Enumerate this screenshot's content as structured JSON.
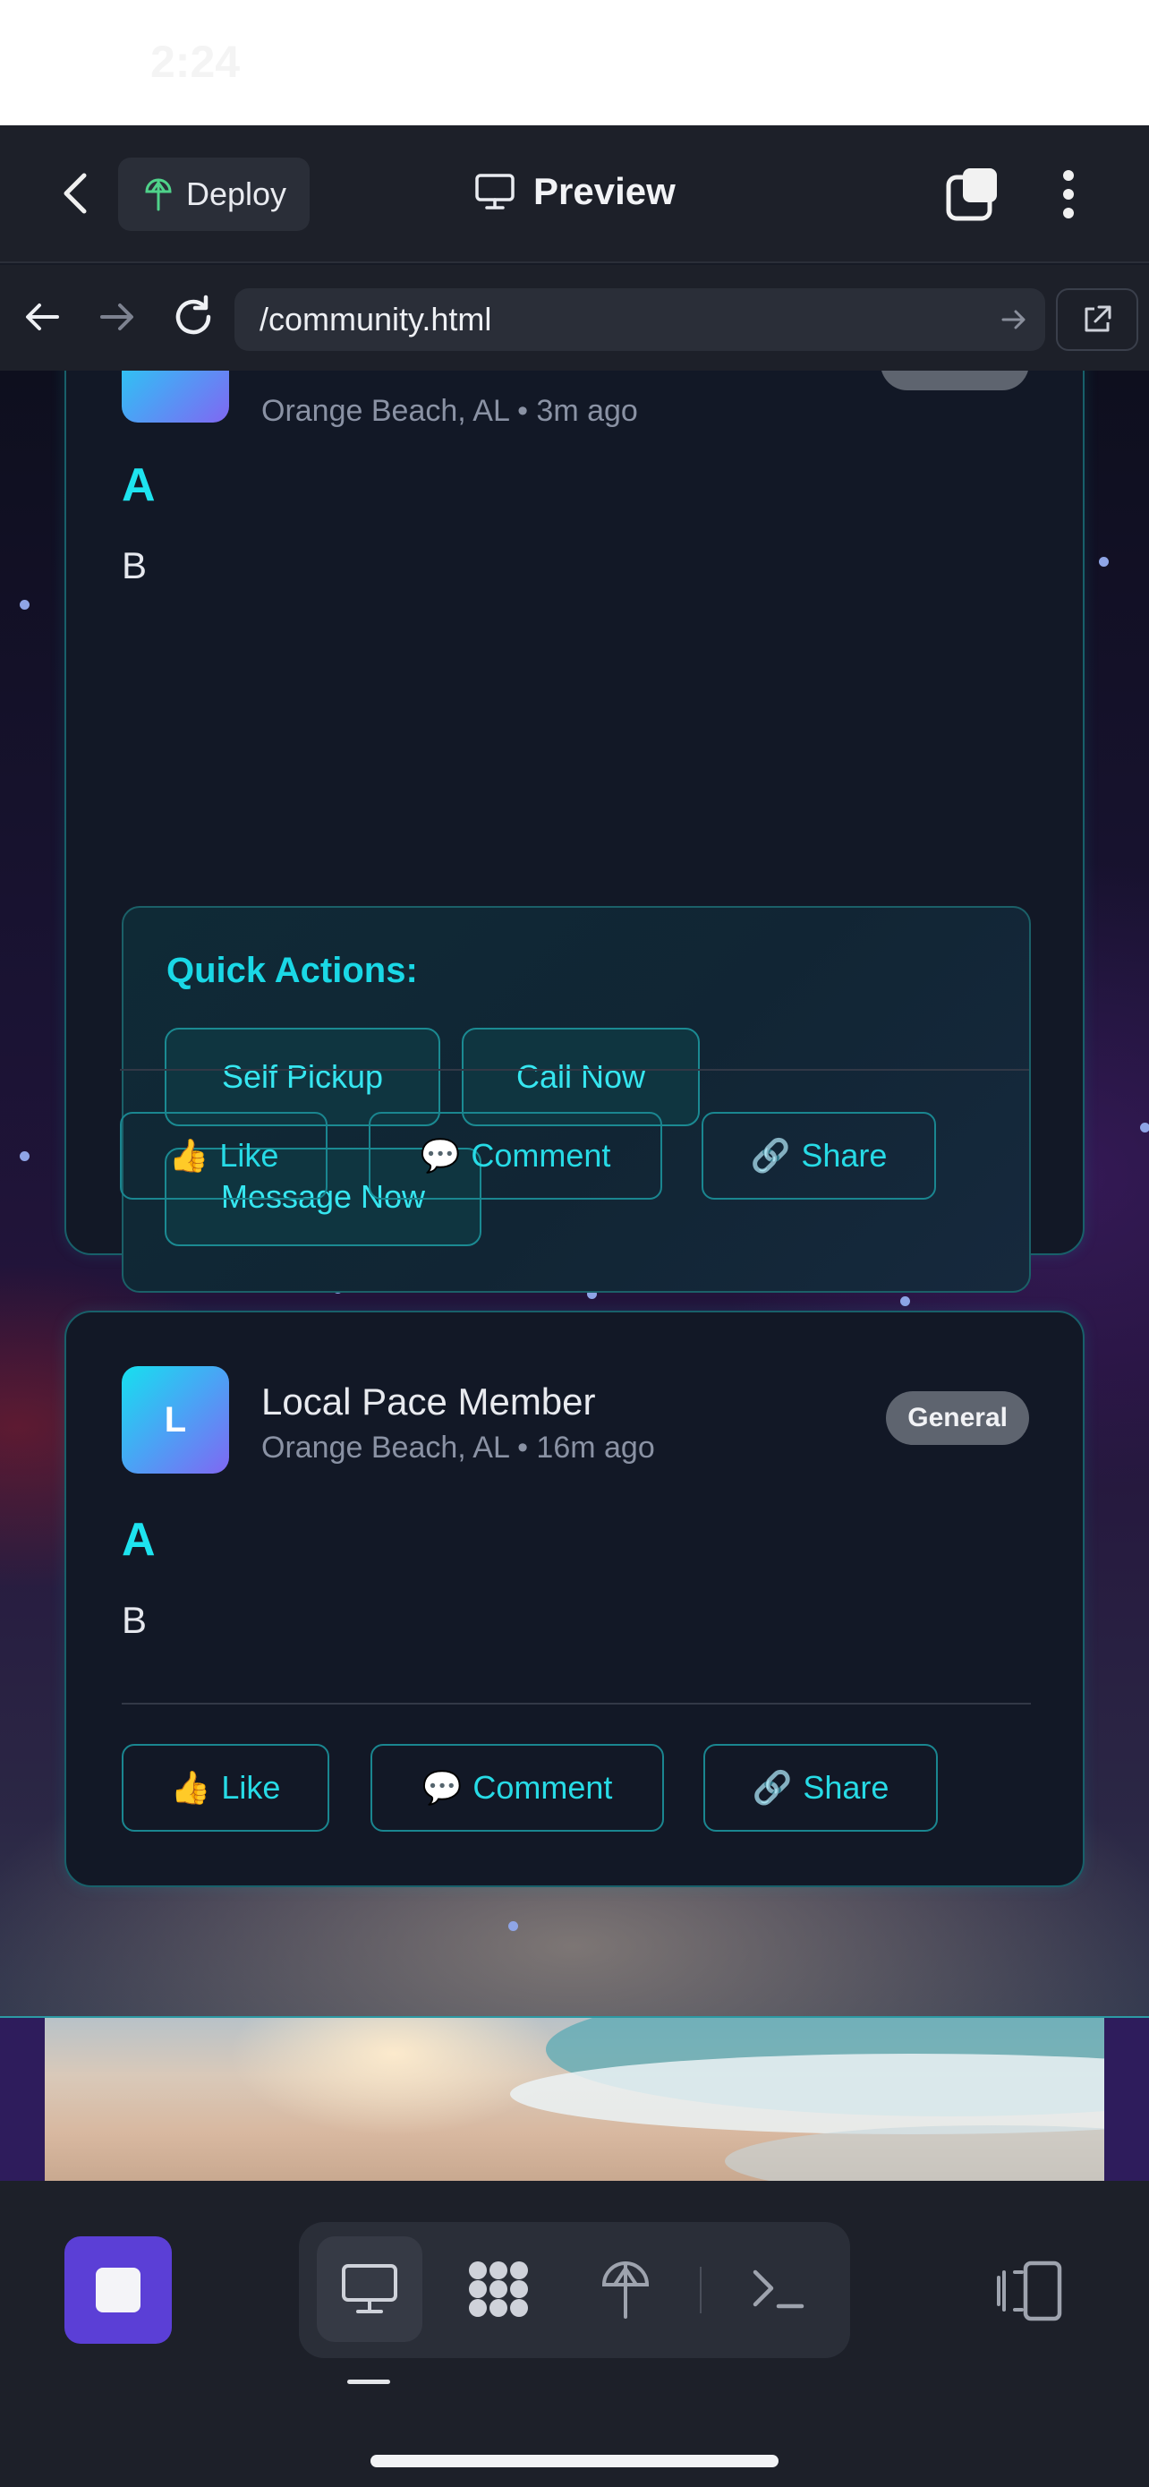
{
  "status_bar": {
    "time": "2:24"
  },
  "top_bar": {
    "deploy_label": "Deploy",
    "preview_label": "Preview"
  },
  "browser": {
    "url": "/community.html"
  },
  "posts": [
    {
      "location": "Orange Beach, AL",
      "time_ago": "3m ago",
      "title": "A",
      "body": "B",
      "quick_actions": {
        "title": "Quick Actions:",
        "buttons": [
          "Self Pickup",
          "Call Now",
          "Message Now"
        ]
      },
      "actions": {
        "like": "Like",
        "comment": "Comment",
        "share": "Share"
      }
    },
    {
      "avatar_letter": "L",
      "author": "Local Pace Member",
      "location": "Orange Beach, AL",
      "time_ago": "16m ago",
      "badge": "General",
      "title": "A",
      "body": "B",
      "actions": {
        "like": "Like",
        "comment": "Comment",
        "share": "Share"
      }
    }
  ],
  "separator": "•",
  "emoji": {
    "like": "👍",
    "comment": "💬",
    "share": "🔗"
  },
  "icons": {
    "top_bar": [
      "back-icon",
      "deploy-icon",
      "monitor-icon",
      "tabs-icon",
      "more-vertical-icon"
    ],
    "browser": [
      "arrow-left-icon",
      "arrow-right-icon",
      "reload-icon",
      "url-go-icon",
      "external-link-icon"
    ],
    "bottom_bar": [
      "stop-icon",
      "monitor-icon",
      "grid-icon",
      "deploy-icon",
      "terminal-icon",
      "device-icon"
    ]
  },
  "colors": {
    "accent_cyan": "#1ee3ef",
    "stop_purple": "#5b3fd6",
    "card_border": "#18606a",
    "badge_gray": "#5e646f"
  }
}
